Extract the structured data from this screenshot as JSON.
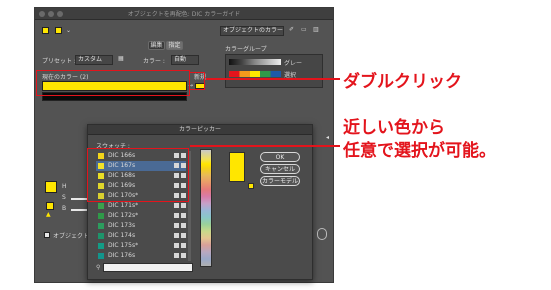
{
  "window": {
    "title": "オブジェクトを再配色: DIC カラーガイド"
  },
  "tabs": {
    "edit": "編集",
    "assign": "指定"
  },
  "top_field": "オブジェクトのカラー",
  "preset": {
    "label": "プリセット :",
    "value": "カスタム"
  },
  "colors": {
    "label": "カラー :",
    "value": "自動"
  },
  "current_colors": {
    "label": "現在のカラー (2)"
  },
  "new_label": "新規",
  "color_group": {
    "title": "カラーグループ",
    "items": [
      {
        "name": "グレー"
      },
      {
        "name": "選択"
      }
    ]
  },
  "callouts": {
    "double_click": "ダブルクリック",
    "line1": "近しい色から",
    "line2": "任意で選択が可能。"
  },
  "picker": {
    "title": "カラーピッカー",
    "swatches_label": "スウォッチ :",
    "swatches": [
      {
        "name": "DIC 166s",
        "color": "#f3d51a"
      },
      {
        "name": "DIC 167s",
        "color": "#f1e22a"
      },
      {
        "name": "DIC 168s",
        "color": "#e9dd25"
      },
      {
        "name": "DIC 169s",
        "color": "#e0d62b"
      },
      {
        "name": "DIC 170s*",
        "color": "#d9cf2f"
      },
      {
        "name": "DIC 171s*",
        "color": "#3aa34c"
      },
      {
        "name": "DIC 172s*",
        "color": "#2f9a49"
      },
      {
        "name": "DIC 173s",
        "color": "#2c9c5e"
      },
      {
        "name": "DIC 174s",
        "color": "#1e946b"
      },
      {
        "name": "DIC 175s*",
        "color": "#139c86"
      },
      {
        "name": "DIC 176s",
        "color": "#12958c"
      }
    ],
    "buttons": {
      "ok": "OK",
      "cancel": "キャンセル",
      "model": "カラーモデル"
    }
  },
  "left_labels": {
    "h": "H",
    "s": "S",
    "b": "B"
  },
  "checkbox_label": "オブジェクト",
  "accent_colors": {
    "red": "#e3141c",
    "yellow": "#ffe600",
    "highlight": "#4a6a95"
  }
}
